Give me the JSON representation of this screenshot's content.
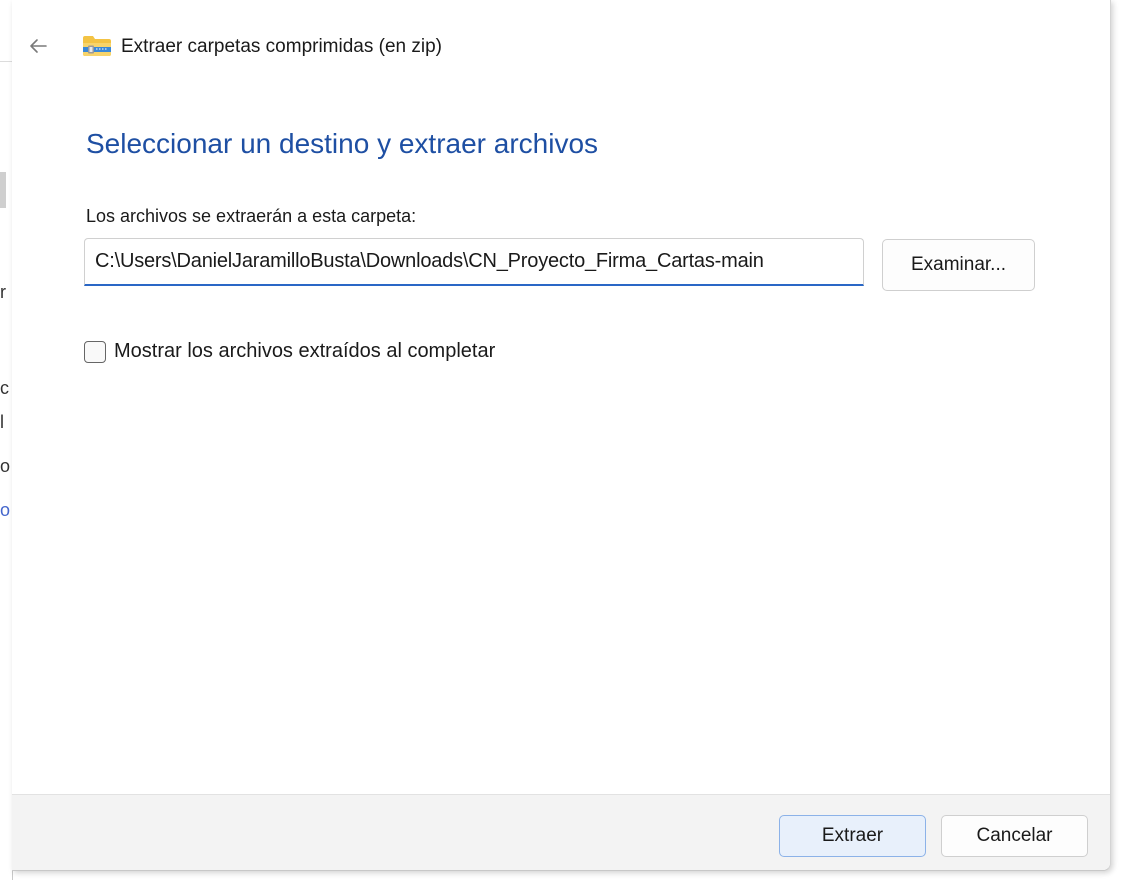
{
  "window": {
    "title": "Extraer carpetas comprimidas (en zip)",
    "back_icon": "arrow-left-icon",
    "app_icon": "zip-folder-icon"
  },
  "main": {
    "heading": "Seleccionar un destino y extraer archivos",
    "destination_label": "Los archivos se extraerán a esta carpeta:",
    "destination_value": "C:\\Users\\DanielJaramilloBusta\\Downloads\\CN_Proyecto_Firma_Cartas-main",
    "browse_label": "Examinar...",
    "show_files_label": "Mostrar los archivos extraídos al completar",
    "show_files_checked": false
  },
  "footer": {
    "extract_label": "Extraer",
    "cancel_label": "Cancelar"
  },
  "colors": {
    "heading": "#1e4fa3",
    "input_focus": "#2a67c6",
    "primary_button_bg": "#e8f0fb",
    "primary_button_border": "#8cb2e8",
    "footer_bg": "#f3f3f3"
  },
  "background_window": {
    "glyphs": [
      "r",
      "c",
      "l",
      "o",
      "o"
    ]
  }
}
